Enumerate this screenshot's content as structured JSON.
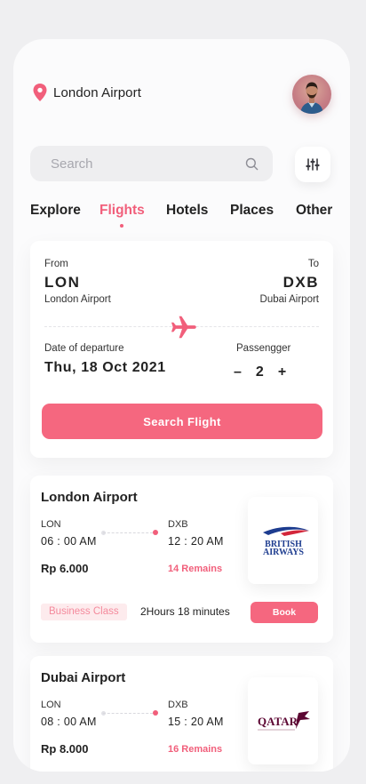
{
  "header": {
    "location": "London Airport"
  },
  "search": {
    "placeholder": "Search"
  },
  "tabs": [
    {
      "label": "Explore",
      "active": false
    },
    {
      "label": "Flights",
      "active": true
    },
    {
      "label": "Hotels",
      "active": false
    },
    {
      "label": "Places",
      "active": false
    },
    {
      "label": "Other",
      "active": false
    }
  ],
  "booking": {
    "from_label": "From",
    "to_label": "To",
    "from_code": "LON",
    "to_code": "DXB",
    "from_airport": "London Airport",
    "to_airport": "Dubai Airport",
    "date_label": "Date of departure",
    "date_value": "Thu, 18 Oct 2021",
    "passenger_label": "Passengger",
    "minus": "–",
    "passenger_count": "2",
    "plus": "+",
    "search_button": "Search Flight"
  },
  "flights": [
    {
      "airport": "London Airport",
      "from_code": "LON",
      "to_code": "DXB",
      "depart": "06 : 00 AM",
      "arrive": "12 : 20 AM",
      "price": "Rp 6.000",
      "remains": "14 Remains",
      "airline": "BRITISH AIRWAYS",
      "airline_line1": "BRITISH",
      "airline_line2": "AIRWAYS",
      "class": "Business Class",
      "duration": "2Hours 18 minutes",
      "book": "Book"
    },
    {
      "airport": "Dubai Airport",
      "from_code": "LON",
      "to_code": "DXB",
      "depart": "08 : 00 AM",
      "arrive": "15 : 20 AM",
      "price": "Rp 8.000",
      "remains": "16 Remains",
      "airline": "QATAR",
      "airline_line1": "QATAR",
      "class": "",
      "duration": "",
      "book": ""
    }
  ],
  "colors": {
    "accent": "#f15f7b",
    "button": "#f5677f",
    "ba_blue": "#1d3c8f",
    "ba_red": "#d3263a",
    "qatar": "#5c0632"
  },
  "icons": {
    "location": "location-pin-icon",
    "search": "search-icon",
    "filter": "sliders-icon",
    "plane": "plane-icon"
  }
}
